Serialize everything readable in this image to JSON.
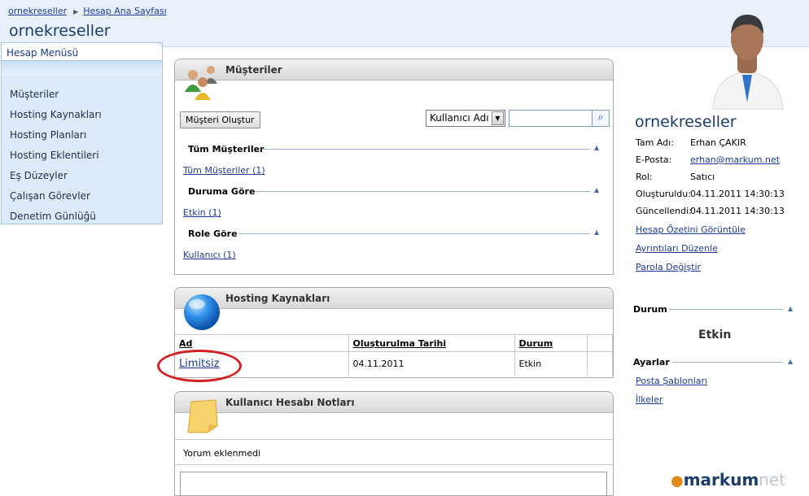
{
  "breadcrumb": {
    "items": [
      "ornekreseller",
      "Hesap Ana Sayfası"
    ]
  },
  "page_title": "ornekreseller",
  "menu": {
    "title": "Hesap Menüsü",
    "items": [
      "Müşteriler",
      "Hosting Kaynakları",
      "Hosting Planları",
      "Hosting Eklentileri",
      "Eş Düzeyler",
      "Çalışan Görevler",
      "Denetim Günlüğü"
    ]
  },
  "customers_panel": {
    "title": "Müşteriler",
    "create_button": "Müşteri Oluştur",
    "search_field_select": "Kullanıcı Adı",
    "search_value": "",
    "groups": [
      {
        "title": "Tüm Müşteriler",
        "link": "Tüm Müşteriler (1)"
      },
      {
        "title": "Duruma Göre",
        "link": "Etkin (1)"
      },
      {
        "title": "Role Göre",
        "link": "Kullanıcı (1)"
      }
    ]
  },
  "hosting_panel": {
    "title": "Hosting Kaynakları",
    "columns": [
      "Ad",
      "Oluşturulma Tarihi",
      "Durum"
    ],
    "rows": [
      {
        "name": "Limitsiz",
        "created": "04.11.2011",
        "status": "Etkin"
      }
    ]
  },
  "notes_panel": {
    "title": "Kullanıcı Hesabı Notları",
    "empty_text": "Yorum eklenmedi"
  },
  "profile": {
    "name": "ornekreseller",
    "fields": [
      {
        "label": "Tam Adı:",
        "value": "Erhan ÇAKIR"
      },
      {
        "label": "E-Posta:",
        "value": "erhan@markum.net"
      },
      {
        "label": "Rol:",
        "value": "Satıcı"
      },
      {
        "label": "Oluşturuldu:",
        "value": "04.11.2011 14:30:13"
      },
      {
        "label": "Güncellendi:",
        "value": "04.11.2011 14:30:13"
      }
    ],
    "links": [
      "Hesap Özetini Görüntüle",
      "Ayrıntıları Düzenle",
      "Parola Değiştir"
    ]
  },
  "status_section": {
    "title": "Durum",
    "value": "Etkin"
  },
  "settings_section": {
    "title": "Ayarlar",
    "links": [
      "Posta Şablonları",
      "İlkeler"
    ]
  },
  "logo": {
    "brand": "markum",
    "suffix": "net"
  },
  "colors": {
    "accent": "#1d3c6e",
    "link": "#1c3b94",
    "highlight_circle": "#d42020"
  }
}
